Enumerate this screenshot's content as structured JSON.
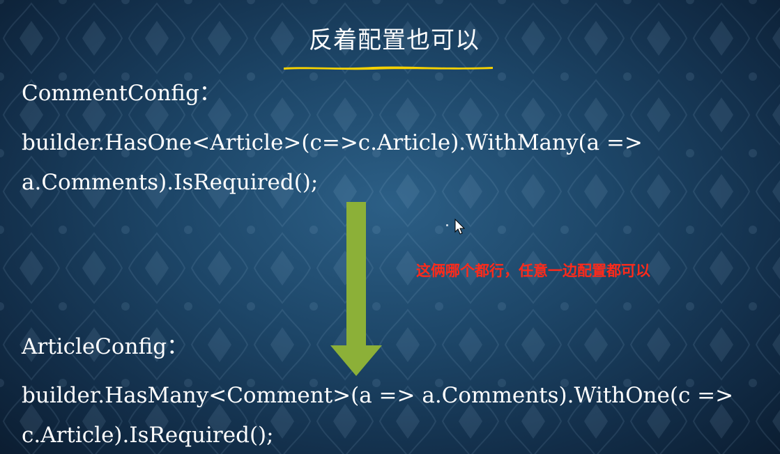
{
  "slide": {
    "title": "反着配置也可以",
    "lines": [
      "CommentConfig：",
      "builder.HasOne<Article>(c=>c.Article).WithMany(a =>",
      "a.Comments).IsRequired();",
      "ArticleConfig：",
      "builder.HasMany<Comment>(a => a.Comments).WithOne(c =>",
      "c.Article).IsRequired();"
    ],
    "note": "这俩哪个都行，任意一边配置都可以"
  },
  "colors": {
    "background": "#1d4668",
    "underline": "#f5d100",
    "arrow": "#8cb038",
    "note": "#ff2a1a",
    "text": "#ffffff"
  },
  "icons": {
    "arrow": "down-arrow-icon",
    "cursor": "mouse-cursor-icon"
  }
}
